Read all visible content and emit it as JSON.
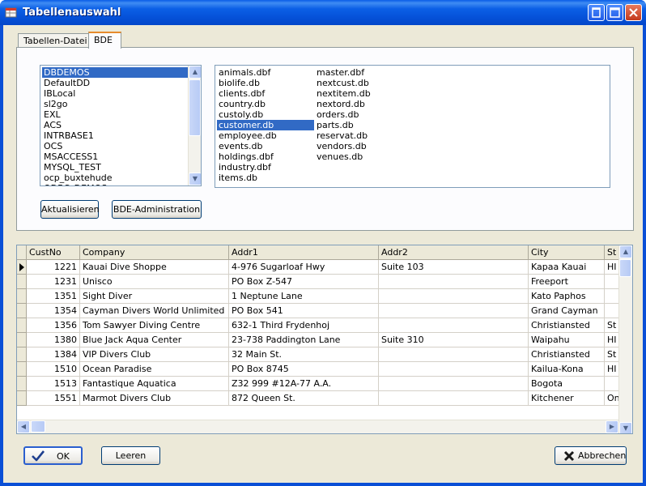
{
  "window": {
    "title": "Tabellenauswahl"
  },
  "tabs": [
    {
      "label": "Tabellen-Datei"
    },
    {
      "label": "BDE"
    }
  ],
  "aliases": {
    "items": [
      "DBDEMOS",
      "DefaultDD",
      "IBLocal",
      "sl2go",
      "EXL",
      "ACS",
      "INTRBASE1",
      "OCS",
      "MSACCESS1",
      "MYSQL_TEST",
      "ocp_buxtehude",
      "ODBC_DEMOS"
    ],
    "selected": "DBDEMOS"
  },
  "tables": {
    "col1": [
      "animals.dbf",
      "biolife.db",
      "clients.dbf",
      "country.db",
      "custoly.db",
      "customer.db",
      "employee.db",
      "events.db",
      "holdings.dbf",
      "industry.dbf",
      "items.db"
    ],
    "col2": [
      "master.dbf",
      "nextcust.db",
      "nextitem.db",
      "nextord.db",
      "orders.db",
      "parts.db",
      "reservat.db",
      "vendors.db",
      "venues.db"
    ],
    "selected": "customer.db"
  },
  "buttons": {
    "refresh": "Aktualisieren",
    "bde_admin": "BDE-Administration",
    "ok": "OK",
    "clear": "Leeren",
    "cancel": "Abbrechen"
  },
  "grid": {
    "columns": [
      "CustNo",
      "Company",
      "Addr1",
      "Addr2",
      "City",
      "St"
    ],
    "rows": [
      [
        "1221",
        "Kauai Dive Shoppe",
        "4-976 Sugarloaf Hwy",
        "Suite 103",
        "Kapaa Kauai",
        "HI"
      ],
      [
        "1231",
        "Unisco",
        "PO Box Z-547",
        "",
        "Freeport",
        ""
      ],
      [
        "1351",
        "Sight Diver",
        "1 Neptune Lane",
        "",
        "Kato Paphos",
        ""
      ],
      [
        "1354",
        "Cayman Divers World Unlimited",
        "PO Box 541",
        "",
        "Grand Cayman",
        ""
      ],
      [
        "1356",
        "Tom Sawyer Diving Centre",
        "632-1 Third Frydenhoj",
        "",
        "Christiansted",
        "St"
      ],
      [
        "1380",
        "Blue Jack Aqua Center",
        "23-738 Paddington Lane",
        "Suite 310",
        "Waipahu",
        "HI"
      ],
      [
        "1384",
        "VIP Divers Club",
        "32 Main St.",
        "",
        "Christiansted",
        "St"
      ],
      [
        "1510",
        "Ocean Paradise",
        "PO Box 8745",
        "",
        "Kailua-Kona",
        "HI"
      ],
      [
        "1513",
        "Fantastique Aquatica",
        "Z32 999 #12A-77 A.A.",
        "",
        "Bogota",
        ""
      ],
      [
        "1551",
        "Marmot Divers Club",
        "872 Queen St.",
        "",
        "Kitchener",
        "On"
      ]
    ],
    "current_row": 0
  },
  "colors": {
    "selection": "#316ac5",
    "titlebar": "#0a5de8",
    "dialog_bg": "#ece9d8"
  }
}
